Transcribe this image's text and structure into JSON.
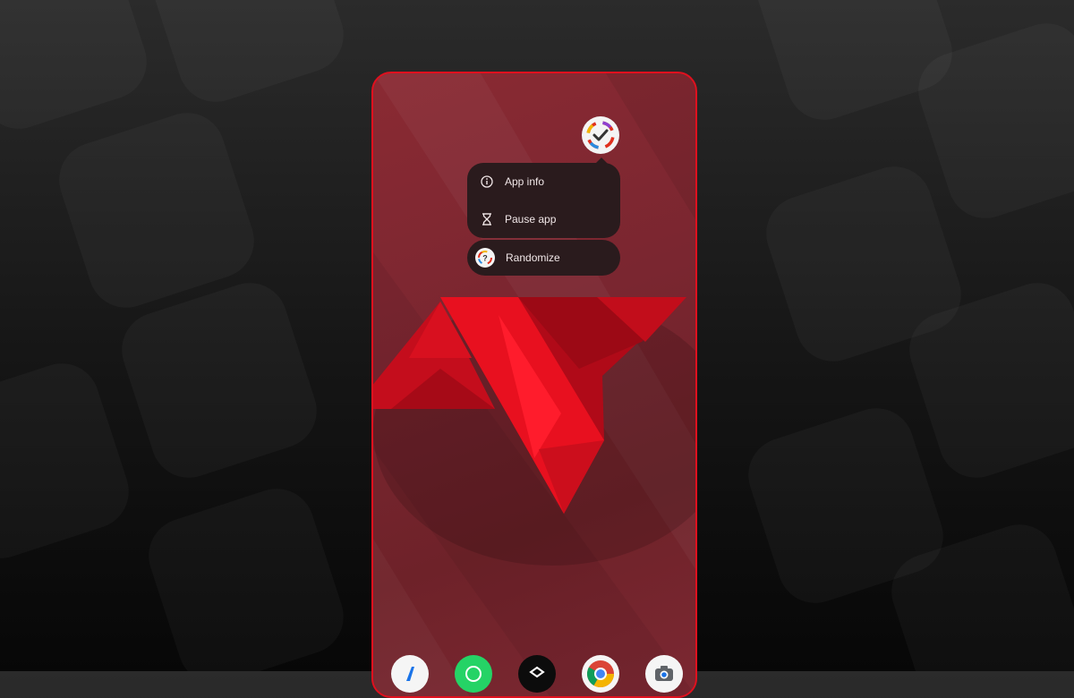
{
  "popup_menu": {
    "items": [
      {
        "label": "App info",
        "icon": "info-icon"
      },
      {
        "label": "Pause app",
        "icon": "hourglass-icon"
      }
    ],
    "shortcut": {
      "label": "Randomize",
      "icon": "randomize-icon"
    }
  },
  "app_icon": {
    "icon": "check-ring-icon"
  },
  "dock": {
    "apps": [
      {
        "icon": "files-app-icon"
      },
      {
        "icon": "whatsapp-icon"
      },
      {
        "icon": "dark-app-icon"
      },
      {
        "icon": "chrome-icon"
      },
      {
        "icon": "camera-icon"
      }
    ]
  },
  "colors": {
    "phone_border": "#e0101e",
    "menu_background": "#2a1b1d",
    "wallpaper_red": "#e8101f"
  }
}
